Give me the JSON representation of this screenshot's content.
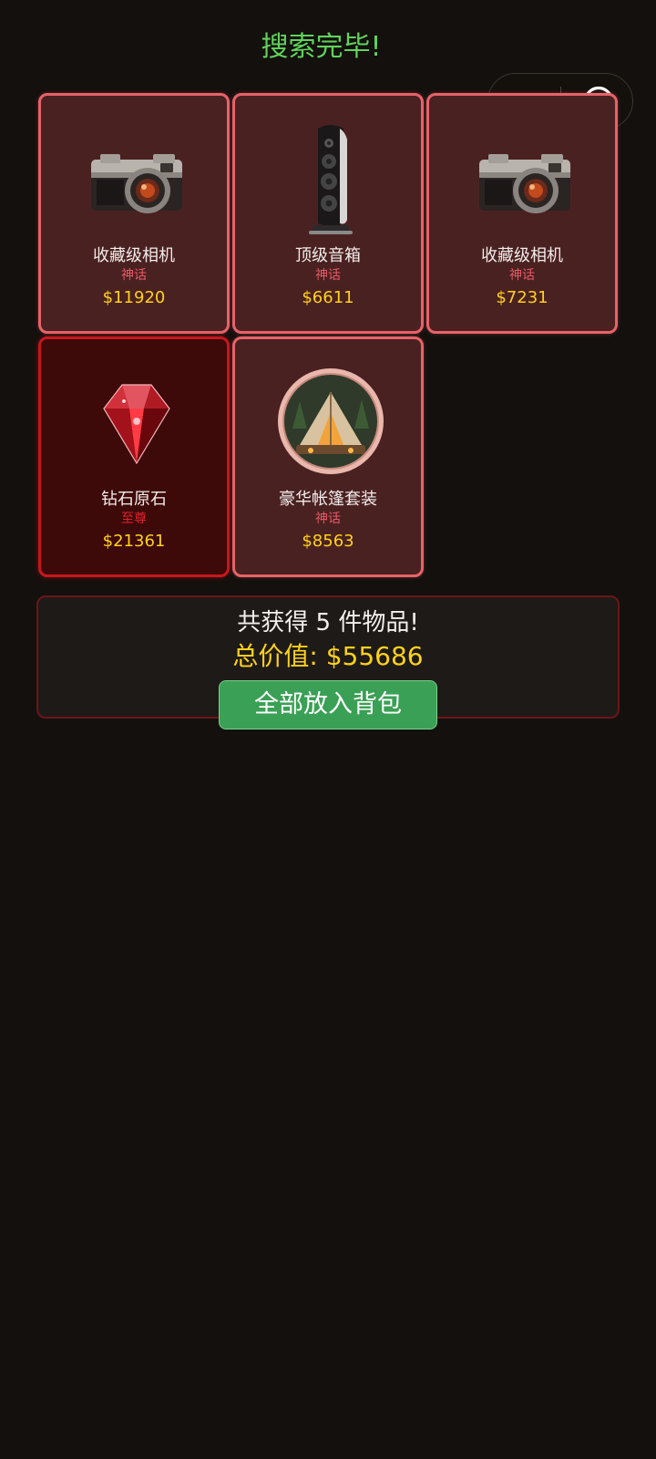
{
  "header": {
    "title": "搜索完毕!"
  },
  "capsule": {
    "more_icon": "more-dots-icon",
    "close_icon": "target-circle-icon"
  },
  "items": [
    {
      "name": "收藏级相机",
      "rarity": "神话",
      "price": "$11920",
      "icon": "vintage-camera-icon"
    },
    {
      "name": "顶级音箱",
      "rarity": "神话",
      "price": "$6611",
      "icon": "tower-speaker-icon"
    },
    {
      "name": "收藏级相机",
      "rarity": "神话",
      "price": "$7231",
      "icon": "vintage-camera-icon"
    },
    {
      "name": "钻石原石",
      "rarity": "至尊",
      "price": "$21361",
      "icon": "red-diamond-icon"
    },
    {
      "name": "豪华帐篷套装",
      "rarity": "神话",
      "price": "$8563",
      "icon": "glamping-tent-icon"
    }
  ],
  "summary": {
    "count_text": "共获得 5 件物品!",
    "total_text": "总价值: $55686",
    "button_label": "全部放入背包"
  },
  "colors": {
    "title": "#5fd35b",
    "mythic_border": "#e8626a",
    "supreme_border": "#c8161c",
    "price": "#ffd21a",
    "button": "#3aa055",
    "background": "#14100d"
  }
}
